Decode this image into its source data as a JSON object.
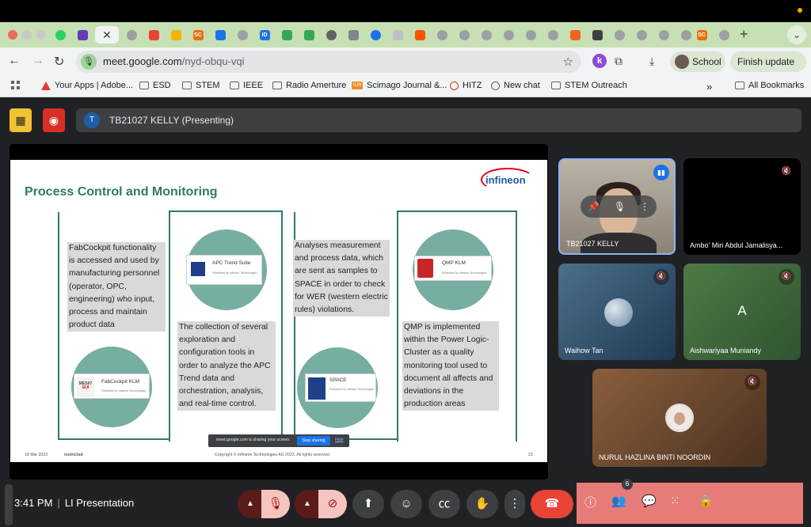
{
  "browser": {
    "url_host": "meet.google.com",
    "url_path": "/nyd-obqu-vqi",
    "profile_label": "School",
    "update_label": "Finish update",
    "tab_favicons": [
      "SC",
      "ID",
      "SC"
    ],
    "bookmarks": [
      {
        "label": "Your Apps | Adobe...",
        "icon": "adobe-icon"
      },
      {
        "label": "ESD",
        "icon": "folder-icon"
      },
      {
        "label": "STEM",
        "icon": "folder-icon"
      },
      {
        "label": "IEEE",
        "icon": "folder-icon"
      },
      {
        "label": "Radio Amerture",
        "icon": "folder-icon"
      },
      {
        "label": "Scimago Journal &...",
        "icon": "sjr-icon"
      },
      {
        "label": "HITZ",
        "icon": "hitz-icon"
      },
      {
        "label": "New chat",
        "icon": "chat-icon"
      },
      {
        "label": "STEM Outreach",
        "icon": "folder-icon"
      }
    ],
    "sjr_badge": "SJR",
    "all_bookmarks": "All Bookmarks",
    "overflow": "»"
  },
  "meet": {
    "presenter_initial": "T",
    "presenter_label": "TB21027 KELLY (Presenting)",
    "share_notice": "meet.google.com is sharing your screen.",
    "stop_sharing": "Stop sharing",
    "hide": "Hide",
    "time": "3:41 PM",
    "separator": "|",
    "meeting_name": "LI Presentation",
    "participant_count": "6",
    "accent_color": "#1a73e8",
    "leave_color": "#ea4335"
  },
  "slide": {
    "title": "Process Control and Monitoring",
    "logo": "infineon",
    "text_fabcockpit": "FabCockpit functionality is accessed and used by manufacturing personnel (operator, OPC, engineering) who input, process and maintain product data",
    "text_apc": "The collection of several exploration and configuration tools in order to analyze the APC Trend data and orchestration, analysis, and real-time control.",
    "text_space": "Analyses measurement and process data, which are sent as samples to SPACE in order to check for WER (western electric rules) violations.",
    "text_qmp": "QMP is implemented within the Power Logic-Cluster as a quality monitoring tool used to document all affects and deviations in the production areas",
    "card_apc": "APC Trend Suite",
    "card_fabcockpit": "FabCockpit KLM",
    "card_space": "SPACE",
    "card_qmp": "QMP KLM",
    "card_sub": "Published by Infineon Technologies",
    "mes_icon_line1": "MES97",
    "mes_icon_line2": "GUI",
    "date": "18 Mar 2023",
    "classification": "restricted",
    "copyright": "Copyright © Infineon Technologies AG 2023. All rights reserved.",
    "page": "22",
    "accent_color": "#2f7a6a"
  },
  "participants": [
    {
      "name": "TB21027 KELLY"
    },
    {
      "name": "Ambo' Miri Abdul Jamalisya..."
    },
    {
      "name": "Waihow Tan"
    },
    {
      "name": "Aishwariyaa Muniandy",
      "initial": "A"
    },
    {
      "name": "NURUL HAZLINA BINTI NOORDIN"
    }
  ]
}
